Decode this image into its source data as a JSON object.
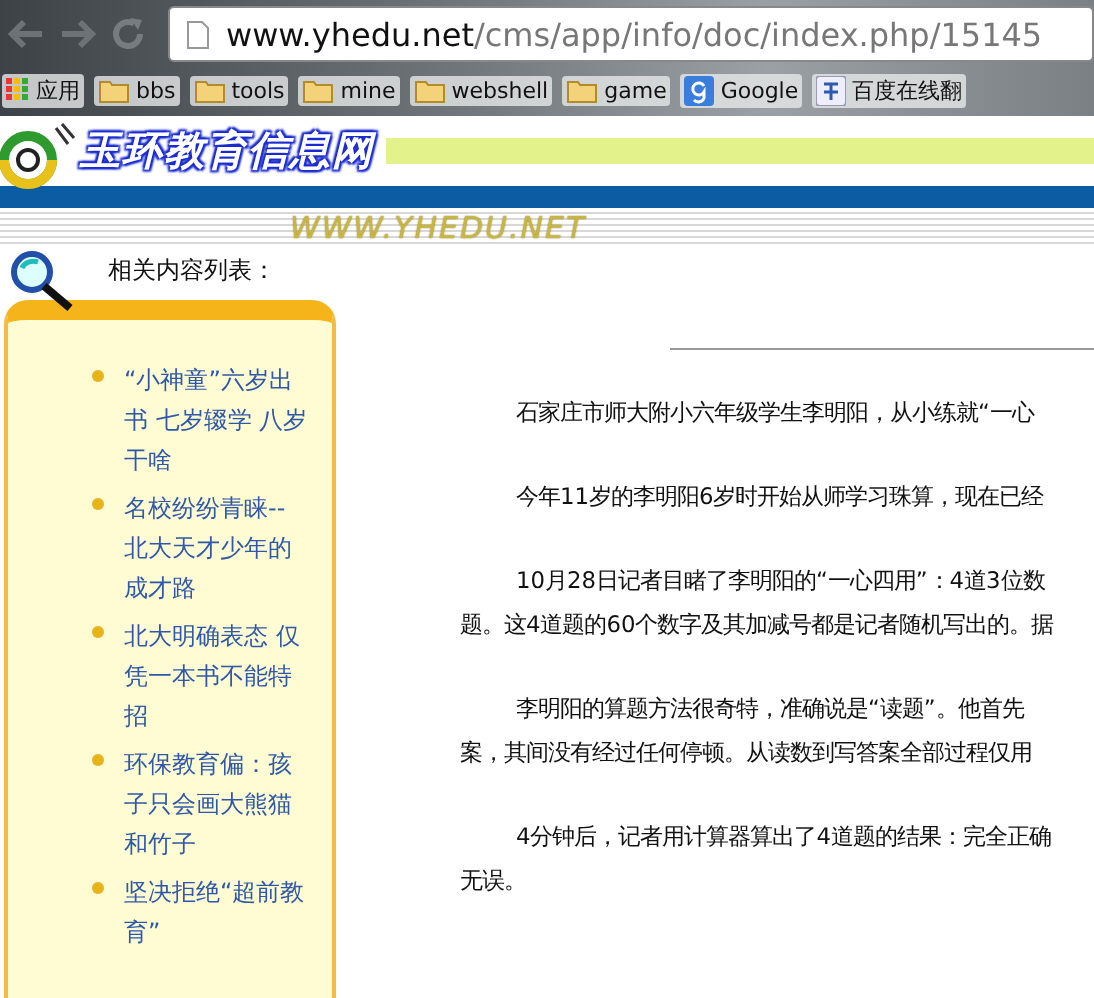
{
  "browser": {
    "url_host": "www.yhedu.net",
    "url_path": "/cms/app/info/doc/index.php/15145",
    "bookmarks": [
      {
        "kind": "apps",
        "label": "应用"
      },
      {
        "kind": "folder",
        "label": "bbs"
      },
      {
        "kind": "folder",
        "label": "tools"
      },
      {
        "kind": "folder",
        "label": "mine"
      },
      {
        "kind": "folder",
        "label": "webshell"
      },
      {
        "kind": "folder",
        "label": "game"
      },
      {
        "kind": "google",
        "label": "Google"
      },
      {
        "kind": "translate",
        "label": "百度在线翻"
      }
    ]
  },
  "header": {
    "site_title": "玉环教育信息网",
    "site_url": "WWW.YHEDU.NET"
  },
  "sidebar": {
    "title": "相关内容列表：",
    "items": [
      "“小神童”六岁出书 七岁辍学 八岁干啥",
      "名校纷纷青睐--北大天才少年的成才路",
      "北大明确表态 仅凭一本书不能特招",
      "环保教育偏：孩子只会画大熊猫和竹子",
      "坚决拒绝“超前教育”"
    ]
  },
  "article": {
    "paragraphs": [
      {
        "lines": [
          "石家庄市师大附小六年级学生李明阳，从小练就“一心"
        ]
      },
      {
        "lines": [
          "今年11岁的李明阳6岁时开始从师学习珠算，现在已经"
        ]
      },
      {
        "lines": [
          "10月28日记者目睹了李明阳的“一心四用”：4道3位数",
          "题。这4道题的60个数字及其加减号都是记者随机写出的。据"
        ]
      },
      {
        "lines": [
          "李明阳的算题方法很奇特，准确说是“读题”。他首先",
          "案，其间没有经过任何停顿。从读数到写答案全部过程仅用"
        ]
      },
      {
        "lines": [
          "4分钟后，记者用计算器算出了4道题的结果：完全正确",
          "无误。"
        ]
      }
    ]
  }
}
